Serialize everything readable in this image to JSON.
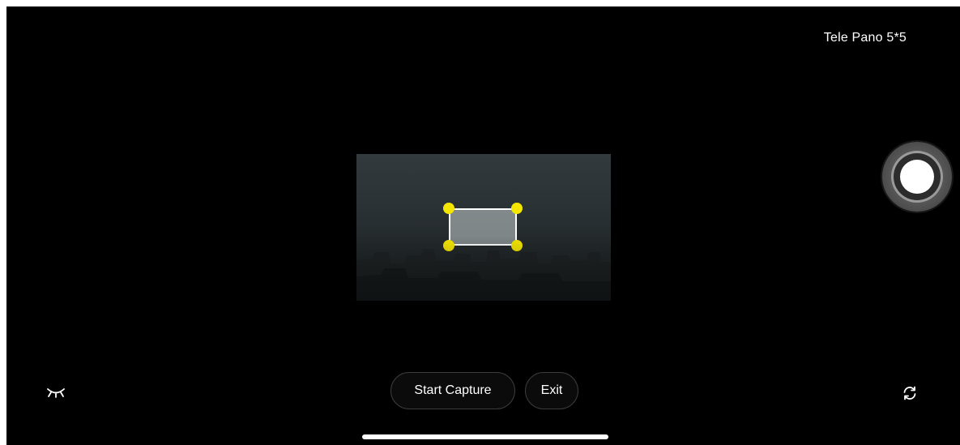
{
  "mode": {
    "title": "Tele Pano 5*5"
  },
  "controls": {
    "start_capture_label": "Start Capture",
    "exit_label": "Exit"
  },
  "icons": {
    "eye": "eye-closed-icon",
    "switch": "switch-camera-icon",
    "shutter": "shutter-icon"
  },
  "colors": {
    "background": "#000000",
    "handle": "#f5e600",
    "selection_border": "#ffffff",
    "text": "#ffffff"
  }
}
